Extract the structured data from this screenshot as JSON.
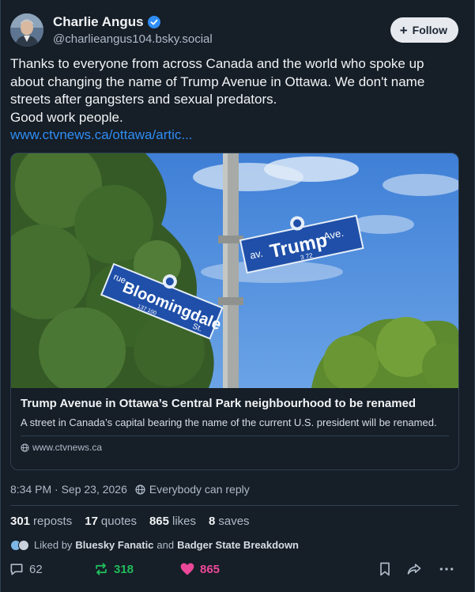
{
  "author": {
    "display_name": "Charlie Angus",
    "handle": "@charlieangus104.bsky.social"
  },
  "follow_button": {
    "label": "Follow"
  },
  "post": {
    "text_lines": [
      "Thanks to everyone from across Canada and the world who spoke up",
      "about changing the name of Trump Avenue in Ottawa. We don't name",
      "streets after gangsters and sexual predators.",
      "Good work people."
    ],
    "link": "www.ctvnews.ca/ottawa/artic..."
  },
  "card": {
    "title": "Trump Avenue in Ottawa’s Central Park neighbourhood to be renamed",
    "description": "A street in Canada’s capital bearing the name of the current U.S. president will be renamed.",
    "domain": "www.ctvnews.ca",
    "sign_1": {
      "prefix": "rue",
      "name": "Bloomingdale",
      "suffix": "St.",
      "numbers": "137  100"
    },
    "sign_2": {
      "prefix": "av.",
      "name": "Trump",
      "suffix": "Ave.",
      "numbers": "3  72"
    }
  },
  "meta": {
    "timestamp": "8:34 PM · Sep 23, 2026",
    "reply_setting": "Everybody can reply"
  },
  "stats": {
    "reposts_count": "301",
    "reposts_label": "reposts",
    "quotes_count": "17",
    "quotes_label": "quotes",
    "likes_count": "865",
    "likes_label": "likes",
    "saves_count": "8",
    "saves_label": "saves"
  },
  "liked_by": {
    "prefix": "Liked by",
    "user_1": "Bluesky Fanatic",
    "conjunction": "and",
    "user_2": "Badger State Breakdown"
  },
  "actions": {
    "reply_count": "62",
    "repost_count": "318",
    "like_count": "865"
  },
  "colors": {
    "background": "#161e27",
    "link": "#2f8df5",
    "repost": "#20bc5c",
    "like": "#ec4899",
    "verified": "#2f8df5"
  }
}
